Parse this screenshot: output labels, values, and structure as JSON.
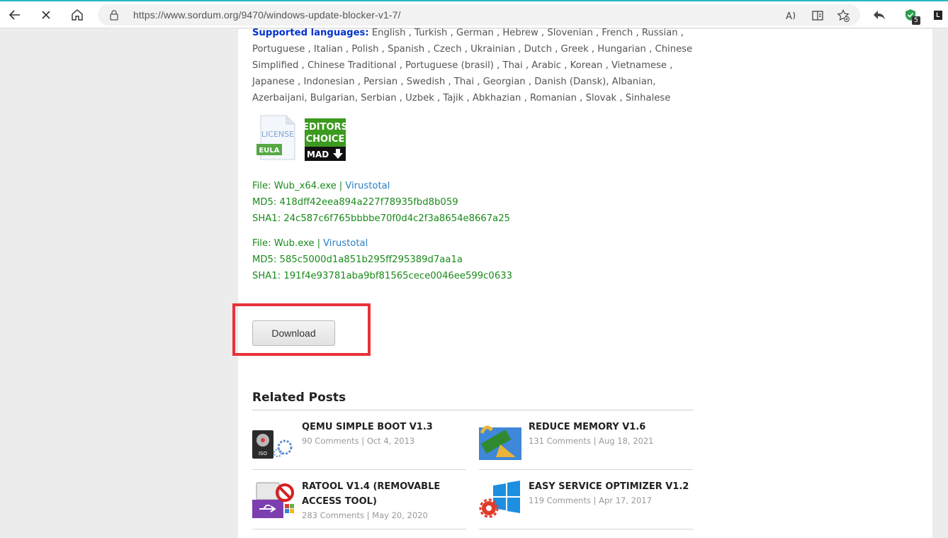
{
  "browser": {
    "url": "https://www.sordum.org/9470/windows-update-blocker-v1-7/",
    "read_aloud_icon": "read-aloud-icon",
    "shield_badge": "5",
    "ext_letter": "L"
  },
  "languages": {
    "label": "Supported languages:",
    "list": " English , Turkish , German , Hebrew , Slovenian , French , Russian , Portuguese , Italian , Polish , Spanish , Czech , Ukrainian , Dutch , Greek , Hungarian , Chinese Simplified , Chinese Traditional , Portuguese (brasil) , Thai , Arabic , Korean , Vietnamese , Japanese , Indonesian , Persian , Swedish , Thai , Georgian , Danish (Dansk), Albanian, Azerbaijani, Bulgarian, Serbian , Uzbek , Tajik , Abkhazian , Romanian , Slovak , Sinhalese"
  },
  "badges": {
    "license_text": "LICENSE",
    "eula_text": "EULA",
    "editors_line1": "EDITORS",
    "editors_line2": "CHOICE",
    "editors_line3": "MAD"
  },
  "files": [
    {
      "file_line": "File: Wub_x64.exe",
      "sep": "|",
      "link": "Virustotal",
      "md5": "MD5: 418dff42eea894a227f78935fbd8b059",
      "sha1": "SHA1: 24c587c6f765bbbbe70f0d4c2f3a8654e8667a25"
    },
    {
      "file_line": "File: Wub.exe",
      "sep": "|",
      "link": "Virustotal",
      "md5": "MD5: 585c5000d1a851b295ff295389d7aa1a",
      "sha1": "SHA1: 191f4e93781aba9bf81565cece0046ee599c0633"
    }
  ],
  "download": {
    "label": "Download"
  },
  "related": {
    "title": "Related Posts",
    "posts": [
      {
        "title": "QEMU SIMPLE BOOT V1.3",
        "comments": "90 Comments",
        "sep": "|",
        "date": "Oct 4, 2013"
      },
      {
        "title": "REDUCE MEMORY V1.6",
        "comments": "131 Comments",
        "sep": "|",
        "date": "Aug 18, 2021"
      },
      {
        "title": "RATOOL V1.4 (REMOVABLE ACCESS TOOL)",
        "comments": "283 Comments",
        "sep": "|",
        "date": "May 20, 2020"
      },
      {
        "title": "EASY SERVICE OPTIMIZER V1.2",
        "comments": "119 Comments",
        "sep": "|",
        "date": "Apr 17, 2017"
      }
    ]
  }
}
